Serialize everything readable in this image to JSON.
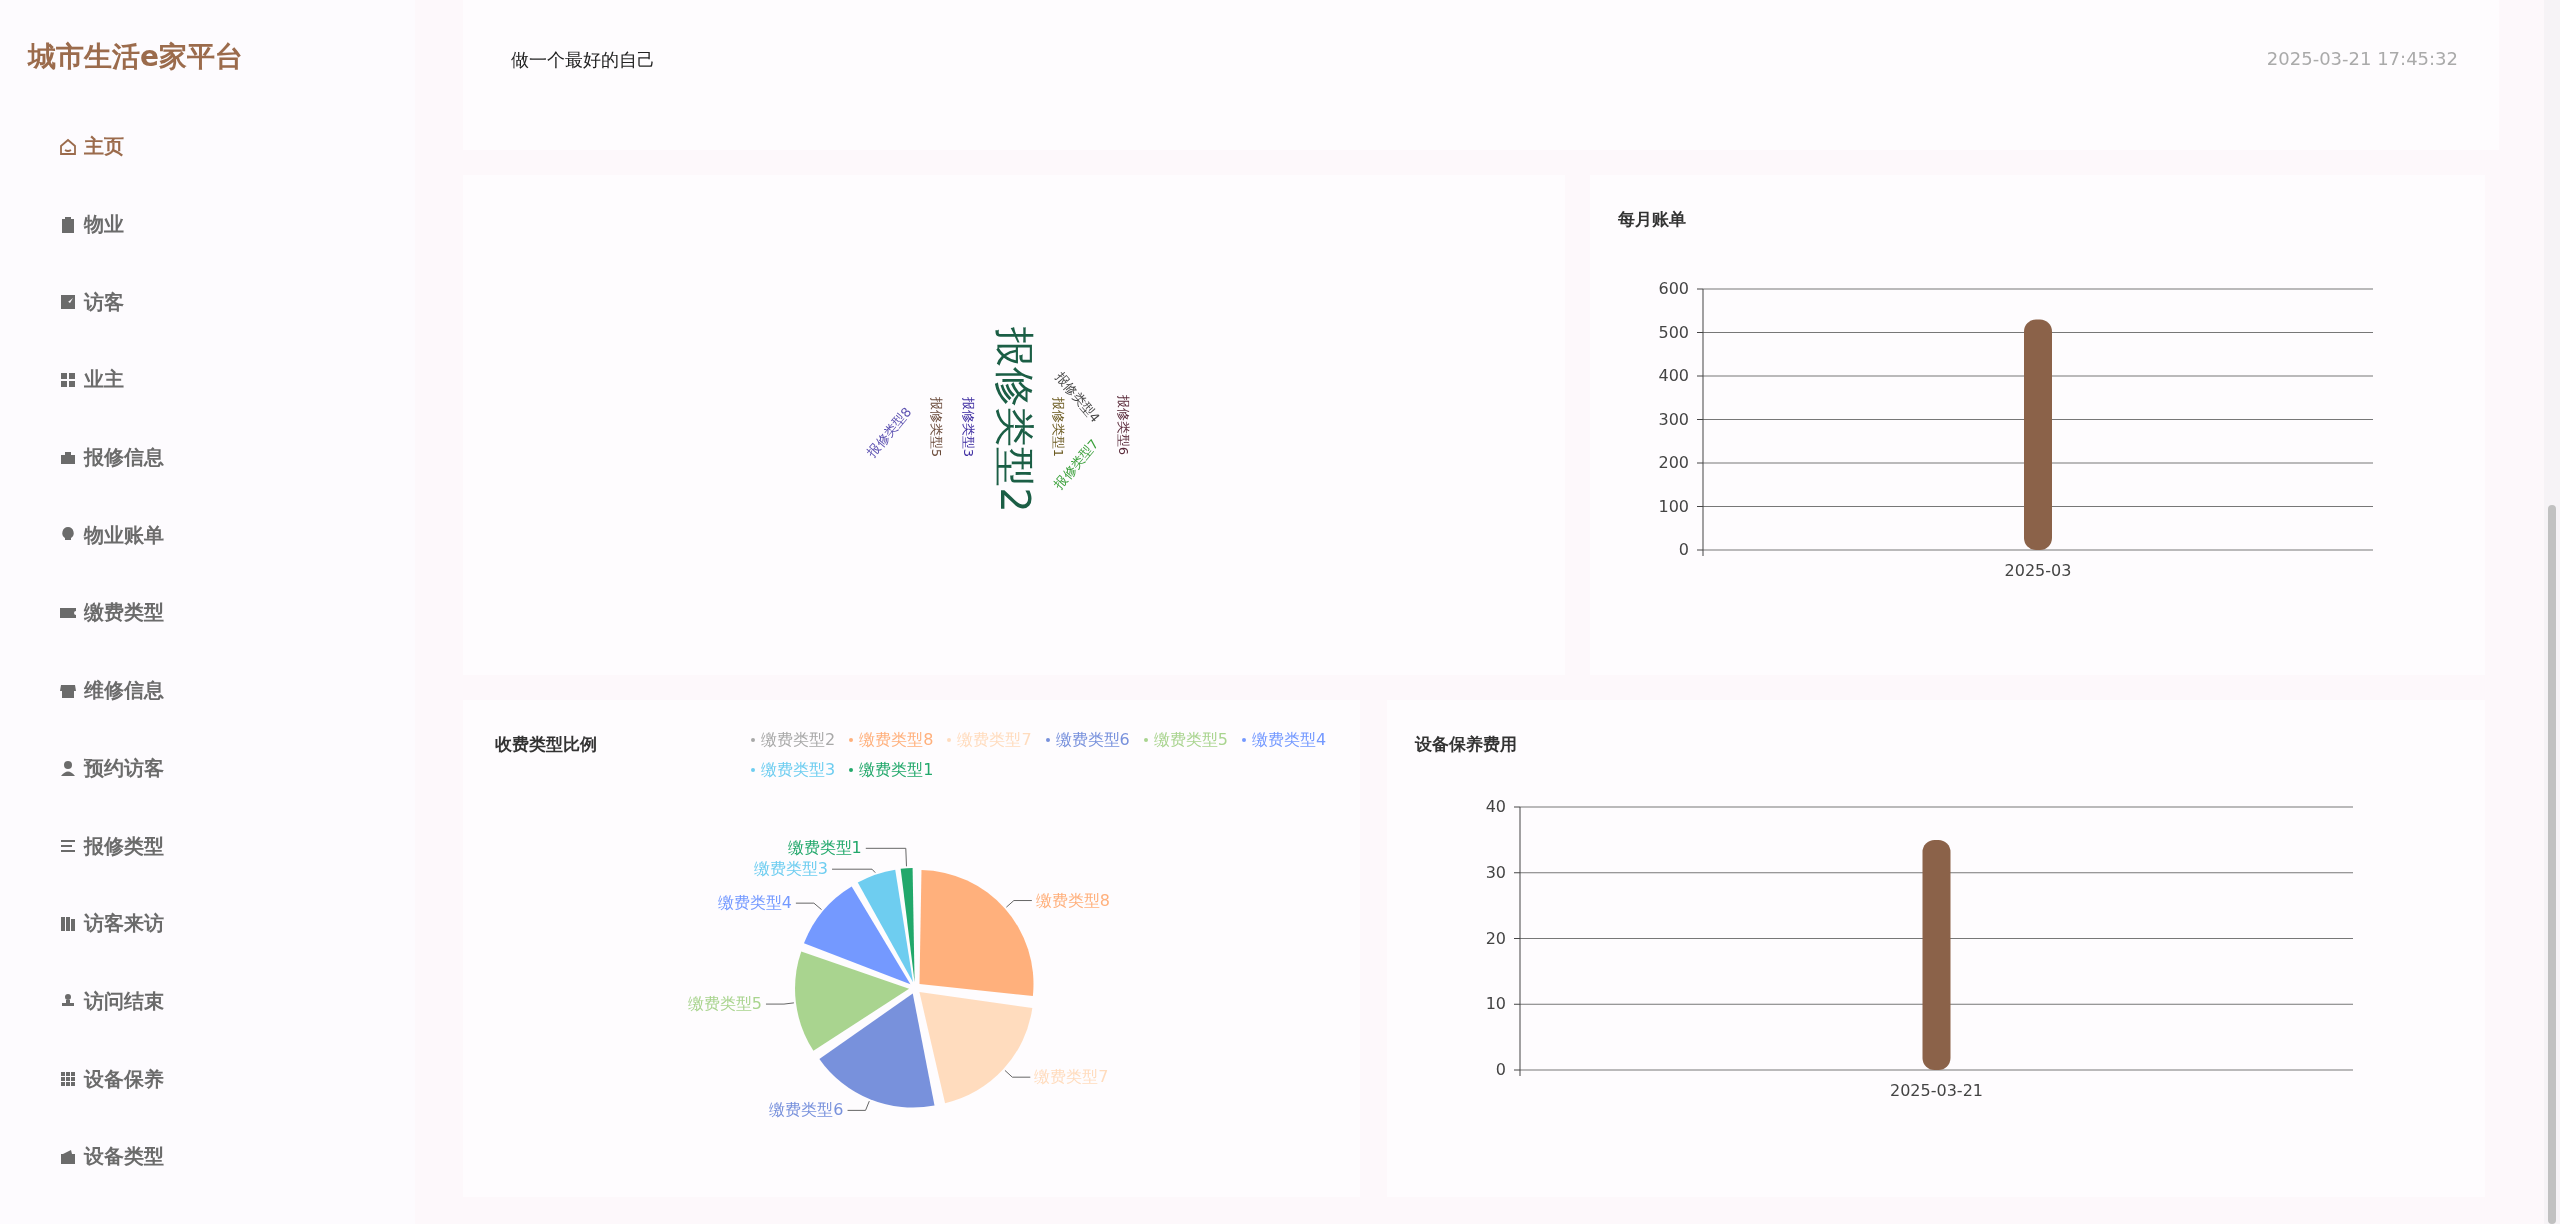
{
  "sidebar": {
    "title": "城市生活e家平台",
    "items": [
      {
        "label": "主页",
        "selected": true
      },
      {
        "label": "物业",
        "selected": false
      },
      {
        "label": "访客",
        "selected": false
      },
      {
        "label": "业主",
        "selected": false
      },
      {
        "label": "报修信息",
        "selected": false
      },
      {
        "label": "物业账单",
        "selected": false
      },
      {
        "label": "缴费类型",
        "selected": false
      },
      {
        "label": "维修信息",
        "selected": false
      },
      {
        "label": "预约访客",
        "selected": false
      },
      {
        "label": "报修类型",
        "selected": false
      },
      {
        "label": "访客来访",
        "selected": false
      },
      {
        "label": "访问结束",
        "selected": false
      },
      {
        "label": "设备保养",
        "selected": false
      },
      {
        "label": "设备类型",
        "selected": false
      }
    ]
  },
  "notice": {
    "text": "做一个最好的自己",
    "time": "2025-03-21 17:45:32"
  },
  "word_cloud": {
    "words": [
      {
        "text": "报修类型2",
        "color": "#1b5e45"
      },
      {
        "text": "报修类型8",
        "color": "#5a4fb0"
      },
      {
        "text": "报修类型5",
        "color": "#6a4a3a"
      },
      {
        "text": "报修类型3",
        "color": "#3b2aa0"
      },
      {
        "text": "报修类型1",
        "color": "#6b5a20"
      },
      {
        "text": "报修类型4",
        "color": "#444444"
      },
      {
        "text": "报修类型7",
        "color": "#3aa03a"
      },
      {
        "text": "报修类型6",
        "color": "#5a2a3a"
      }
    ]
  },
  "monthly_bill": {
    "title": "每月账单",
    "chart_data": {
      "type": "bar",
      "categories": [
        "2025-03"
      ],
      "values": [
        530
      ],
      "grid": true,
      "ylim": [
        0,
        600
      ],
      "yticks": [
        0,
        100,
        200,
        300,
        400,
        500,
        600
      ]
    }
  },
  "fee_ratio": {
    "title": "收费类型比例",
    "legend": [
      {
        "label": "缴费类型2",
        "selected": false
      },
      {
        "label": "缴费类型8",
        "color": "#ffb07c",
        "selected": true
      },
      {
        "label": "缴费类型7",
        "color": "#ffdcbe",
        "selected": true
      },
      {
        "label": "缴费类型6",
        "color": "#7891dc",
        "selected": true
      },
      {
        "label": "缴费类型5",
        "color": "#a9d48f",
        "selected": true
      },
      {
        "label": "缴费类型4",
        "color": "#7499ff",
        "selected": true
      },
      {
        "label": "缴费类型3",
        "color": "#6ecdf0",
        "selected": true
      },
      {
        "label": "缴费类型1",
        "color": "#22a86b",
        "selected": true
      }
    ],
    "slices": [
      {
        "label": "缴费类型1",
        "color": "#22a86b"
      },
      {
        "label": "缴费类型3",
        "color": "#6ecdf0"
      },
      {
        "label": "缴费类型8",
        "color": "#ffb07c"
      },
      {
        "label": "缴费类型4",
        "color": "#7499ff"
      },
      {
        "label": "缴费类型5",
        "color": "#a9d48f"
      },
      {
        "label": "缴费类型7",
        "color": "#ffdcbe"
      },
      {
        "label": "缴费类型6",
        "color": "#7891dc"
      }
    ]
  },
  "maintenance_cost": {
    "title": "设备保养费用",
    "chart_data": {
      "type": "bar",
      "categories": [
        "2025-03-21"
      ],
      "values": [
        35
      ],
      "grid": true,
      "ylim": [
        0,
        40
      ],
      "yticks": [
        0,
        10,
        20,
        30,
        40
      ]
    }
  }
}
